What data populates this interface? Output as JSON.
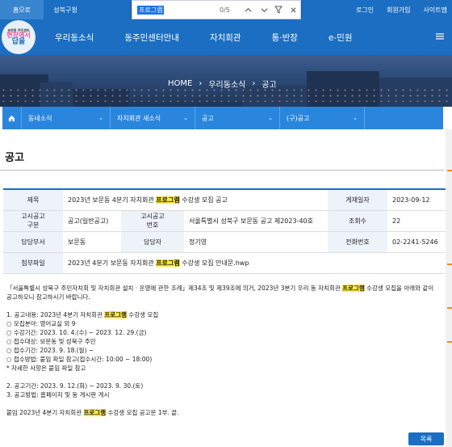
{
  "topbar": {
    "tabs": [
      "홈으로",
      "성북구청"
    ],
    "links": [
      "로그인",
      "회원가입",
      "사이트맵"
    ]
  },
  "find": {
    "query": "프로그램",
    "count": "0/5",
    "icons": [
      "chevron-up-icon",
      "chevron-down-icon",
      "filter-icon",
      "close-icon"
    ]
  },
  "logo": {
    "lines": [
      "보문동 주민센터",
      "현장에서",
      "답을"
    ]
  },
  "nav": [
    "우리동소식",
    "동주민센터안내",
    "자치회관",
    "통·반장",
    "e-민원"
  ],
  "breadcrumb": [
    "HOME",
    "우리동소식",
    "공고"
  ],
  "subnav": [
    "동네소식",
    "자치회관 새소식",
    "공고",
    "(구)공고"
  ],
  "page_title": "공고",
  "info": {
    "title_label": "제목",
    "title_pre": "2023년 보문동 4분기 자치회관 ",
    "title_hl": "프로그램",
    "title_post": " 수강생 모집 공고",
    "date_label": "게재일자",
    "date": "2023-09-12",
    "type_label": "고시공고\n구분",
    "type": "공고(일반공고)",
    "number_label": "고시공고\n번호",
    "number": "서울특별시 성북구 보문동 공고 제2023-40호",
    "views_label": "조회수",
    "views": "22",
    "dept_label": "담당부서",
    "dept": "보문동",
    "person_label": "담당자",
    "person": "정기영",
    "phone_label": "전화번호",
    "phone": "02-2241-5246",
    "attach_label": "첨부파일",
    "attach_pre": "2023년 4분기 보문동 자치회관 ",
    "attach_hl": "프로그램",
    "attach_post": " 수강생 모집 안내문.hwp"
  },
  "body": {
    "intro_a": "「서울특별시 성북구 주민자치회 및 자치회관 설치 · 운영에 관한 조례」제34조 및 제39조에 의거, 2023년 3분기 우리 동 자치회관 ",
    "intro_b": " 수강생 모집을 아래와 같이",
    "intro_c": "공고하오니 참고하시기 바랍니다.",
    "item1_a": "1. 공고내용: 2023년 4분기 자치회관 ",
    "item1_b": " 수강생 모집",
    "l1": "○ 모집분야: 영어교실 외 9",
    "l2": "○ 수강기간: 2023. 10. 4.(수) ~ 2023. 12. 29.(금)",
    "l3": "○ 접수대상: 보문동 및 성북구 주민",
    "l4": "○ 접수기간: 2023. 9. 18.(월) ~",
    "l5": "○ 접수방법: 붙임 파일 참고(접수시간: 10:00 ~ 18:00)",
    "l6": "* 자세한 사항은 붙임 파일 참고",
    "l7": "2. 공고기간: 2023. 9. 12.(화) ~ 2023. 9. 30.(토)",
    "l8": "3. 공고방법: 홈페이지 및 동 게시판 게시",
    "att_a": "붙임 2023년 4분기 자치회관 ",
    "att_b": " 수강생 모집 공고문 1부. 끝.",
    "hl": "프로그램"
  },
  "list_button": "목록",
  "colors": {
    "primary": "#1b6ec2",
    "subnav": "#2a86dd",
    "highlight": "#ffeb3b"
  }
}
